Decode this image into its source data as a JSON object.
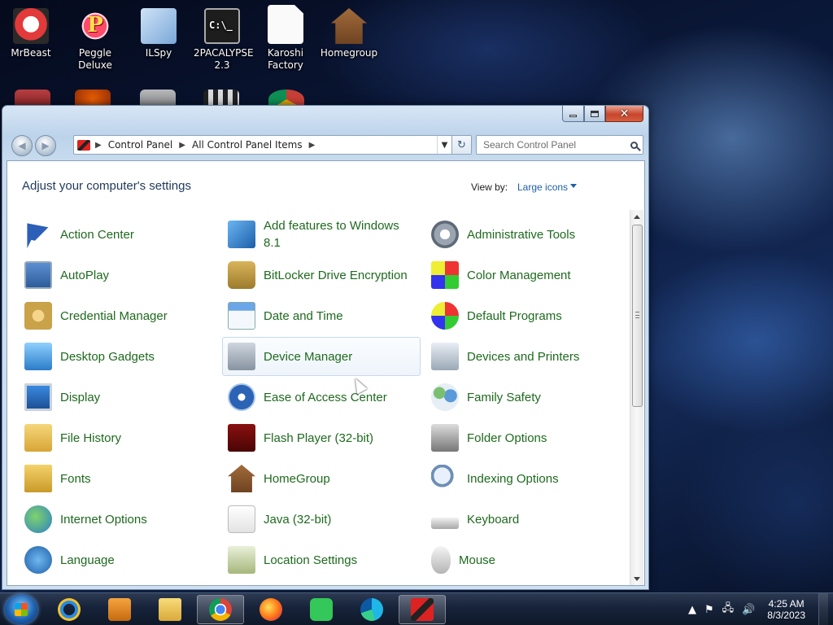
{
  "desktop": {
    "icons": [
      {
        "label": "MrBeast"
      },
      {
        "label": "Peggle Deluxe"
      },
      {
        "label": "ILSpy"
      },
      {
        "label": "2PACALYPSE 2.3"
      },
      {
        "label": "Karoshi Factory"
      },
      {
        "label": "Homegroup"
      }
    ]
  },
  "window": {
    "caption_buttons": {
      "minimize": "minimize",
      "maximize": "maximize",
      "close": "close"
    },
    "address": {
      "crumbs": [
        "Control Panel",
        "All Control Panel Items"
      ]
    },
    "search": {
      "placeholder": "Search Control Panel"
    },
    "heading": "Adjust your computer's settings",
    "view_by_label": "View by:",
    "view_by_value": "Large icons",
    "items": [
      {
        "label": "Action Center",
        "icon": "flag-icon"
      },
      {
        "label": "Add features to Windows 8.1",
        "icon": "add-features-icon"
      },
      {
        "label": "Administrative Tools",
        "icon": "admin-tools-icon"
      },
      {
        "label": "AutoPlay",
        "icon": "autoplay-icon"
      },
      {
        "label": "BitLocker Drive Encryption",
        "icon": "bitlocker-icon"
      },
      {
        "label": "Color Management",
        "icon": "color-management-icon"
      },
      {
        "label": "Credential Manager",
        "icon": "credential-vault-icon"
      },
      {
        "label": "Date and Time",
        "icon": "calendar-clock-icon"
      },
      {
        "label": "Default Programs",
        "icon": "default-programs-icon"
      },
      {
        "label": "Desktop Gadgets",
        "icon": "gadgets-icon"
      },
      {
        "label": "Device Manager",
        "icon": "device-manager-icon"
      },
      {
        "label": "Devices and Printers",
        "icon": "printer-icon"
      },
      {
        "label": "Display",
        "icon": "monitor-icon"
      },
      {
        "label": "Ease of Access Center",
        "icon": "ease-of-access-icon"
      },
      {
        "label": "Family Safety",
        "icon": "family-safety-icon"
      },
      {
        "label": "File History",
        "icon": "file-history-icon"
      },
      {
        "label": "Flash Player (32-bit)",
        "icon": "flash-player-icon"
      },
      {
        "label": "Folder Options",
        "icon": "folder-options-icon"
      },
      {
        "label": "Fonts",
        "icon": "fonts-icon"
      },
      {
        "label": "HomeGroup",
        "icon": "homegroup-icon"
      },
      {
        "label": "Indexing Options",
        "icon": "indexing-icon"
      },
      {
        "label": "Internet Options",
        "icon": "internet-options-icon"
      },
      {
        "label": "Java (32-bit)",
        "icon": "java-icon"
      },
      {
        "label": "Keyboard",
        "icon": "keyboard-icon"
      },
      {
        "label": "Language",
        "icon": "language-icon"
      },
      {
        "label": "Location Settings",
        "icon": "location-settings-icon"
      },
      {
        "label": "Mouse",
        "icon": "mouse-icon"
      }
    ],
    "hovered_item": "Device Manager"
  },
  "taskbar": {
    "pinned": [
      {
        "name": "internet-explorer-icon"
      },
      {
        "name": "media-player-icon"
      },
      {
        "name": "file-explorer-icon"
      },
      {
        "name": "chrome-icon"
      },
      {
        "name": "firefox-icon"
      },
      {
        "name": "spotify-like-icon"
      },
      {
        "name": "edge-icon"
      },
      {
        "name": "control-panel-icon"
      }
    ],
    "active_app": "control-panel-icon",
    "clock_time": "4:25 AM",
    "clock_date": "8/3/2023"
  },
  "colors": {
    "item_label": "#1e6a1e",
    "heading": "#1e395b",
    "link_blue": "#1f5fa8"
  }
}
